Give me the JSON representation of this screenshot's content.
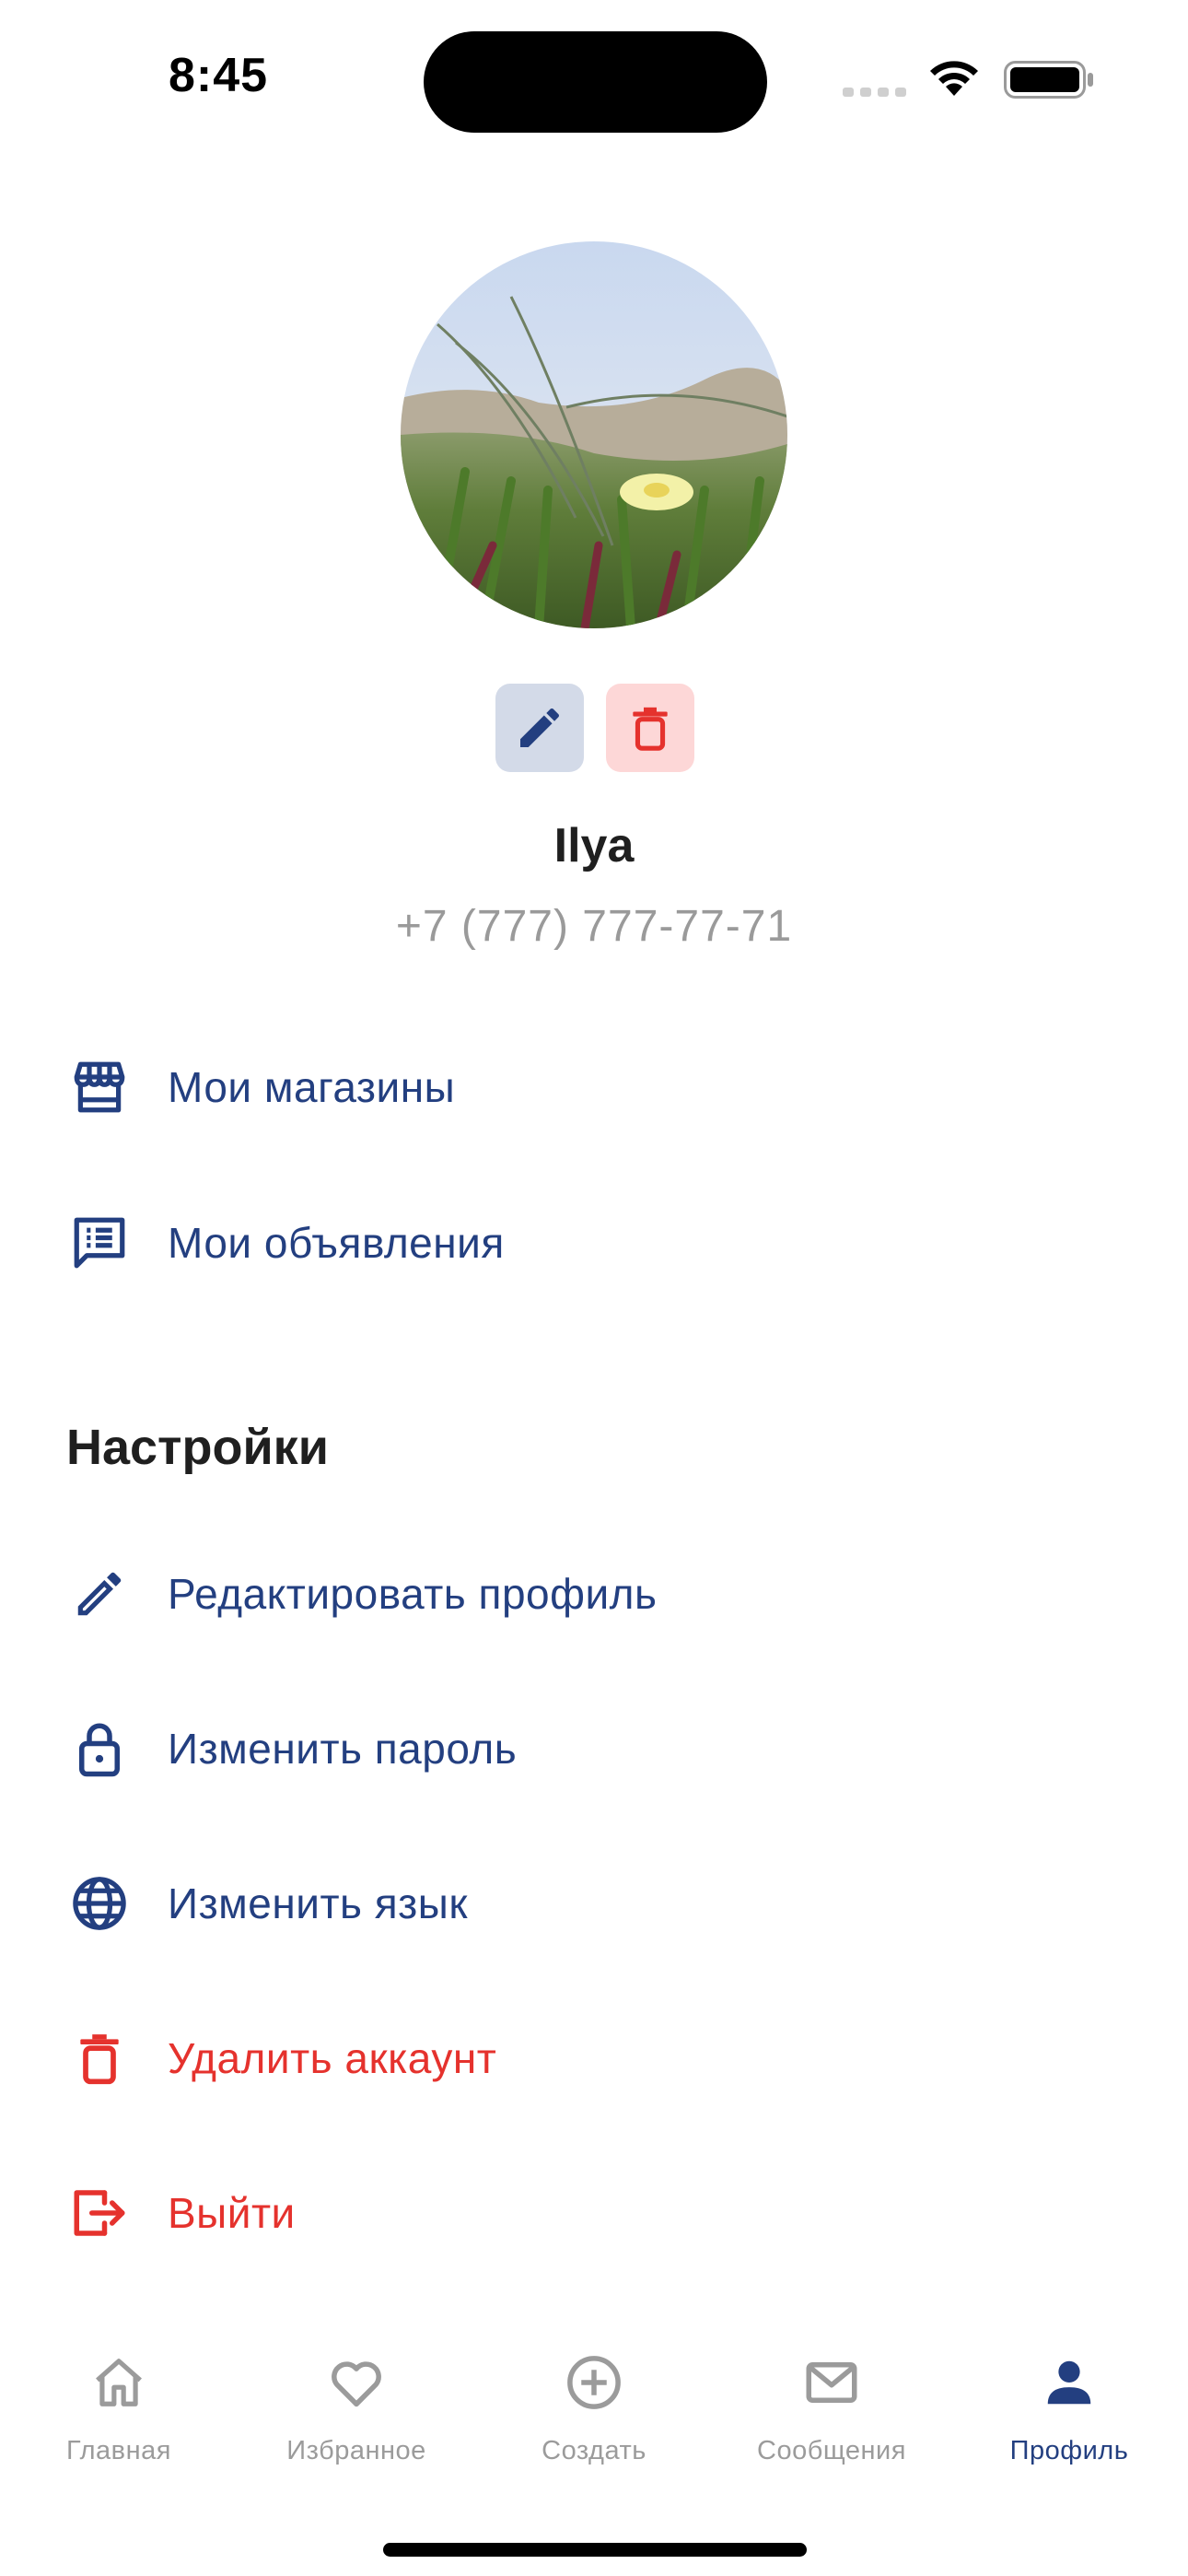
{
  "status_bar": {
    "time": "8:45"
  },
  "profile": {
    "name": "Ilya",
    "phone": "+7 (777) 777-77-71"
  },
  "menu": [
    {
      "label": "Мои магазины",
      "icon": "store-icon"
    },
    {
      "label": "Мои объявления",
      "icon": "list-icon"
    }
  ],
  "settings": {
    "title": "Настройки",
    "items": [
      {
        "label": "Редактировать профиль",
        "icon": "pencil-icon"
      },
      {
        "label": "Изменить пароль",
        "icon": "lock-icon"
      },
      {
        "label": "Изменить язык",
        "icon": "globe-icon"
      },
      {
        "label": "Удалить аккаунт",
        "icon": "trash-icon"
      },
      {
        "label": "Выйти",
        "icon": "logout-icon"
      }
    ]
  },
  "tabs": [
    {
      "label": "Главная",
      "icon": "home-icon"
    },
    {
      "label": "Избранное",
      "icon": "heart-icon"
    },
    {
      "label": "Создать",
      "icon": "plus-circle-icon"
    },
    {
      "label": "Сообщения",
      "icon": "mail-icon"
    },
    {
      "label": "Профиль",
      "icon": "person-icon",
      "active": true
    }
  ],
  "colors": {
    "primary": "#233f80",
    "danger": "#e5322d",
    "inactive": "#9b9b9b",
    "edit_bg": "#d3dae8",
    "delete_bg": "#fdd7d7"
  }
}
